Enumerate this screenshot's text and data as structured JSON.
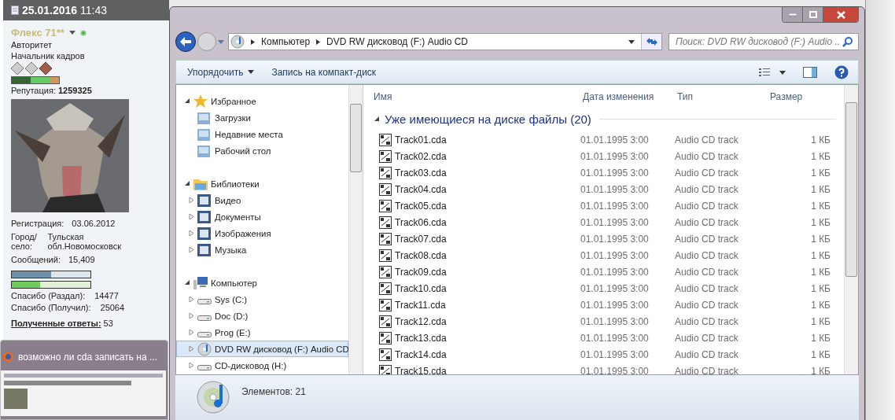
{
  "forum_post": {
    "date": "25.01.2016",
    "time": "11:43",
    "username": "Флекс 71**",
    "online": true,
    "rank": "Авторитет",
    "title": "Начальник кадров",
    "reputation_label": "Репутация:",
    "reputation": "1259325",
    "details": [
      {
        "label": "Регистрация:",
        "value": "03.06.2012"
      },
      {
        "label": "Город/село:",
        "value": "Тульская обл.Новомосковск"
      },
      {
        "label": "Сообщений:",
        "value": "15,409"
      }
    ],
    "bars": [
      {
        "level": 0.5
      },
      {
        "level": 0.36
      }
    ],
    "thanks": [
      {
        "label": "Спасибо (Раздал):",
        "value": "14477"
      },
      {
        "label": "Спасибо (Получил):",
        "value": "25064"
      }
    ],
    "answers_label": "Полученные ответы:",
    "answers": "53"
  },
  "taskbar_preview": {
    "title": "возможно ли cda записать на ..."
  },
  "explorer": {
    "breadcrumbs": [
      "Компьютер",
      "DVD RW дисковод (F:) Audio CD"
    ],
    "search": {
      "placeholder": "Поиск: DVD RW дисковод (F:) Audio ..."
    },
    "toolbar": [
      "Упорядочить",
      "Запись на компакт-диск"
    ],
    "nav": [
      {
        "label": "Избранное",
        "expanded": true,
        "selected": false,
        "children": [
          {
            "label": "Загрузки",
            "selected": false
          },
          {
            "label": "Недавние места",
            "selected": false
          },
          {
            "label": "Рабочий стол",
            "selected": false
          }
        ]
      },
      {
        "label": "Библиотеки",
        "expanded": true,
        "selected": false,
        "children": [
          {
            "label": "Видео",
            "expanded": false,
            "selected": false
          },
          {
            "label": "Документы",
            "expanded": false,
            "selected": false
          },
          {
            "label": "Изображения",
            "expanded": false,
            "selected": false
          },
          {
            "label": "Музыка",
            "expanded": false,
            "selected": false
          }
        ]
      },
      {
        "label": "Компьютер",
        "expanded": true,
        "selected": false,
        "children": [
          {
            "label": "Sys (C:)",
            "expanded": false,
            "selected": false
          },
          {
            "label": "Doc (D:)",
            "expanded": false,
            "selected": false
          },
          {
            "label": "Prog (E:)",
            "expanded": false,
            "selected": false
          },
          {
            "label": "DVD RW дисковод (F:) Audio CD",
            "expanded": false,
            "selected": true
          },
          {
            "label": "CD-дисковод (H:)",
            "expanded": false,
            "selected": false
          }
        ]
      }
    ],
    "columns": [
      "Имя",
      "Дата изменения",
      "Тип",
      "Размер"
    ],
    "group": "Уже имеющиеся на диске файлы (20)",
    "files": [
      {
        "name": "Track01.cda",
        "date": "01.01.1995 3:00",
        "type": "Audio CD track",
        "size": "1 КБ"
      },
      {
        "name": "Track02.cda",
        "date": "01.01.1995 3:00",
        "type": "Audio CD track",
        "size": "1 КБ"
      },
      {
        "name": "Track03.cda",
        "date": "01.01.1995 3:00",
        "type": "Audio CD track",
        "size": "1 КБ"
      },
      {
        "name": "Track04.cda",
        "date": "01.01.1995 3:00",
        "type": "Audio CD track",
        "size": "1 КБ"
      },
      {
        "name": "Track05.cda",
        "date": "01.01.1995 3:00",
        "type": "Audio CD track",
        "size": "1 КБ"
      },
      {
        "name": "Track06.cda",
        "date": "01.01.1995 3:00",
        "type": "Audio CD track",
        "size": "1 КБ"
      },
      {
        "name": "Track07.cda",
        "date": "01.01.1995 3:00",
        "type": "Audio CD track",
        "size": "1 КБ"
      },
      {
        "name": "Track08.cda",
        "date": "01.01.1995 3:00",
        "type": "Audio CD track",
        "size": "1 КБ"
      },
      {
        "name": "Track09.cda",
        "date": "01.01.1995 3:00",
        "type": "Audio CD track",
        "size": "1 КБ"
      },
      {
        "name": "Track10.cda",
        "date": "01.01.1995 3:00",
        "type": "Audio CD track",
        "size": "1 КБ"
      },
      {
        "name": "Track11.cda",
        "date": "01.01.1995 3:00",
        "type": "Audio CD track",
        "size": "1 КБ"
      },
      {
        "name": "Track12.cda",
        "date": "01.01.1995 3:00",
        "type": "Audio CD track",
        "size": "1 КБ"
      },
      {
        "name": "Track13.cda",
        "date": "01.01.1995 3:00",
        "type": "Audio CD track",
        "size": "1 КБ"
      },
      {
        "name": "Track14.cda",
        "date": "01.01.1995 3:00",
        "type": "Audio CD track",
        "size": "1 КБ"
      },
      {
        "name": "Track15.cda",
        "date": "01.01.1995 3:00",
        "type": "Audio CD track",
        "size": "1 КБ"
      }
    ],
    "status": "Элементов: 21"
  }
}
